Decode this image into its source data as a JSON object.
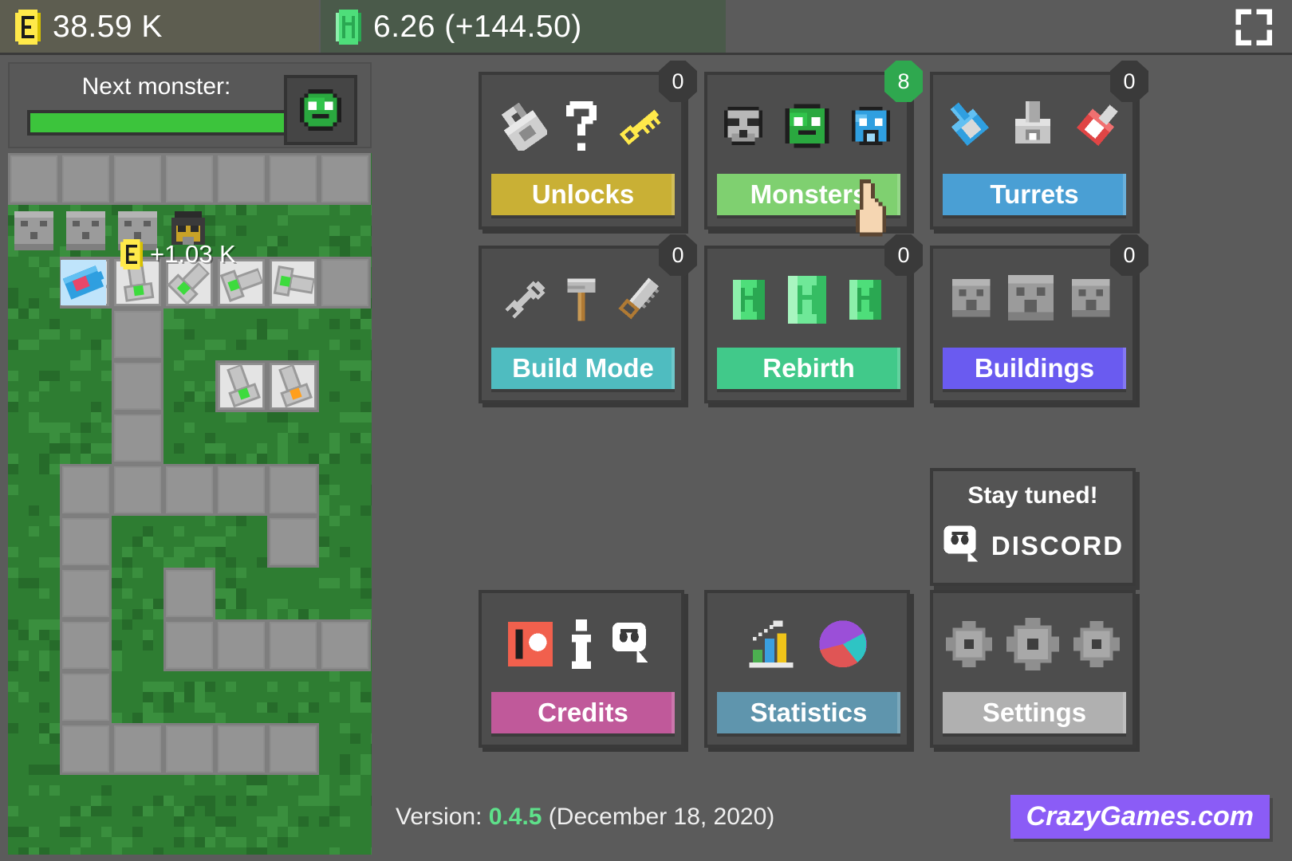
{
  "topbar": {
    "coins": {
      "icon": "coin-icon",
      "value": "38.59 K"
    },
    "gems": {
      "icon": "gem-icon",
      "value": "6.26 (+144.50)"
    },
    "fullscreen_label": "fullscreen-icon"
  },
  "game_panel": {
    "next_monster_label": "Next monster:",
    "next_monster_progress": 97,
    "next_monster_icon": "green-slime-icon",
    "floating_reward": "+1.03 K",
    "floating_reward_icon": "coin-icon"
  },
  "menu": {
    "cards": [
      {
        "key": "unlocks",
        "label": "Unlocks",
        "badge": "0",
        "badge_color": "#3a3a3a",
        "btn_color": "#c9b035",
        "icons": [
          "lock-icon",
          "question-mark-icon",
          "key-icon"
        ]
      },
      {
        "key": "monsters",
        "label": "Monsters",
        "badge": "8",
        "badge_color": "#2fa84f",
        "btn_color": "#7fd070",
        "icons": [
          "skull-monster-icon",
          "green-slime-icon",
          "blue-slime-icon"
        ]
      },
      {
        "key": "turrets",
        "label": "Turrets",
        "badge": "0",
        "badge_color": "#3a3a3a",
        "btn_color": "#4a9fd4",
        "icons": [
          "blue-turret-icon",
          "gray-turret-icon",
          "red-turret-icon"
        ]
      },
      {
        "key": "build-mode",
        "label": "Build Mode",
        "badge": "0",
        "badge_color": "#3a3a3a",
        "btn_color": "#4fbcc0",
        "icons": [
          "wrench-icon",
          "hammer-icon",
          "saw-icon"
        ]
      },
      {
        "key": "rebirth",
        "label": "Rebirth",
        "badge": "0",
        "badge_color": "#3a3a3a",
        "btn_color": "#41c98a",
        "icons": [
          "green-gem-icon",
          "green-gem-icon",
          "green-gem-icon"
        ]
      },
      {
        "key": "buildings",
        "label": "Buildings",
        "badge": "0",
        "badge_color": "#3a3a3a",
        "btn_color": "#6a5bf0",
        "icons": [
          "building-block-icon",
          "building-block-icon",
          "building-block-icon"
        ]
      },
      {
        "key": "credits",
        "label": "Credits",
        "badge": "",
        "badge_color": "#3a3a3a",
        "btn_color": "#c0599a",
        "icons": [
          "patreon-icon",
          "info-icon",
          "discord-icon"
        ]
      },
      {
        "key": "statistics",
        "label": "Statistics",
        "badge": "",
        "badge_color": "#3a3a3a",
        "btn_color": "#5f95ad",
        "icons": [
          "bar-chart-icon",
          "pie-chart-icon"
        ]
      },
      {
        "key": "settings",
        "label": "Settings",
        "badge": "",
        "badge_color": "#3a3a3a",
        "btn_color": "#b0b0b0",
        "icons": [
          "gear-icon",
          "gear-icon",
          "gear-icon"
        ]
      }
    ],
    "discord_promo": {
      "title": "Stay tuned!",
      "wordmark": "DISCORD",
      "icon": "discord-icon"
    }
  },
  "footer": {
    "version_prefix": "Version: ",
    "version_number": "0.4.5",
    "version_date": " (December 18, 2020)",
    "crazygames_label": "CrazyGames.com"
  },
  "colors": {
    "background": "#5b5b5b",
    "card_bg": "#4d4d4d",
    "card_border": "#3a3a3a",
    "grass": "#2e7d32",
    "path": "#8a8a8a",
    "accent_version": "#5ee08a",
    "crazygames_purple": "#8b5cf6"
  }
}
